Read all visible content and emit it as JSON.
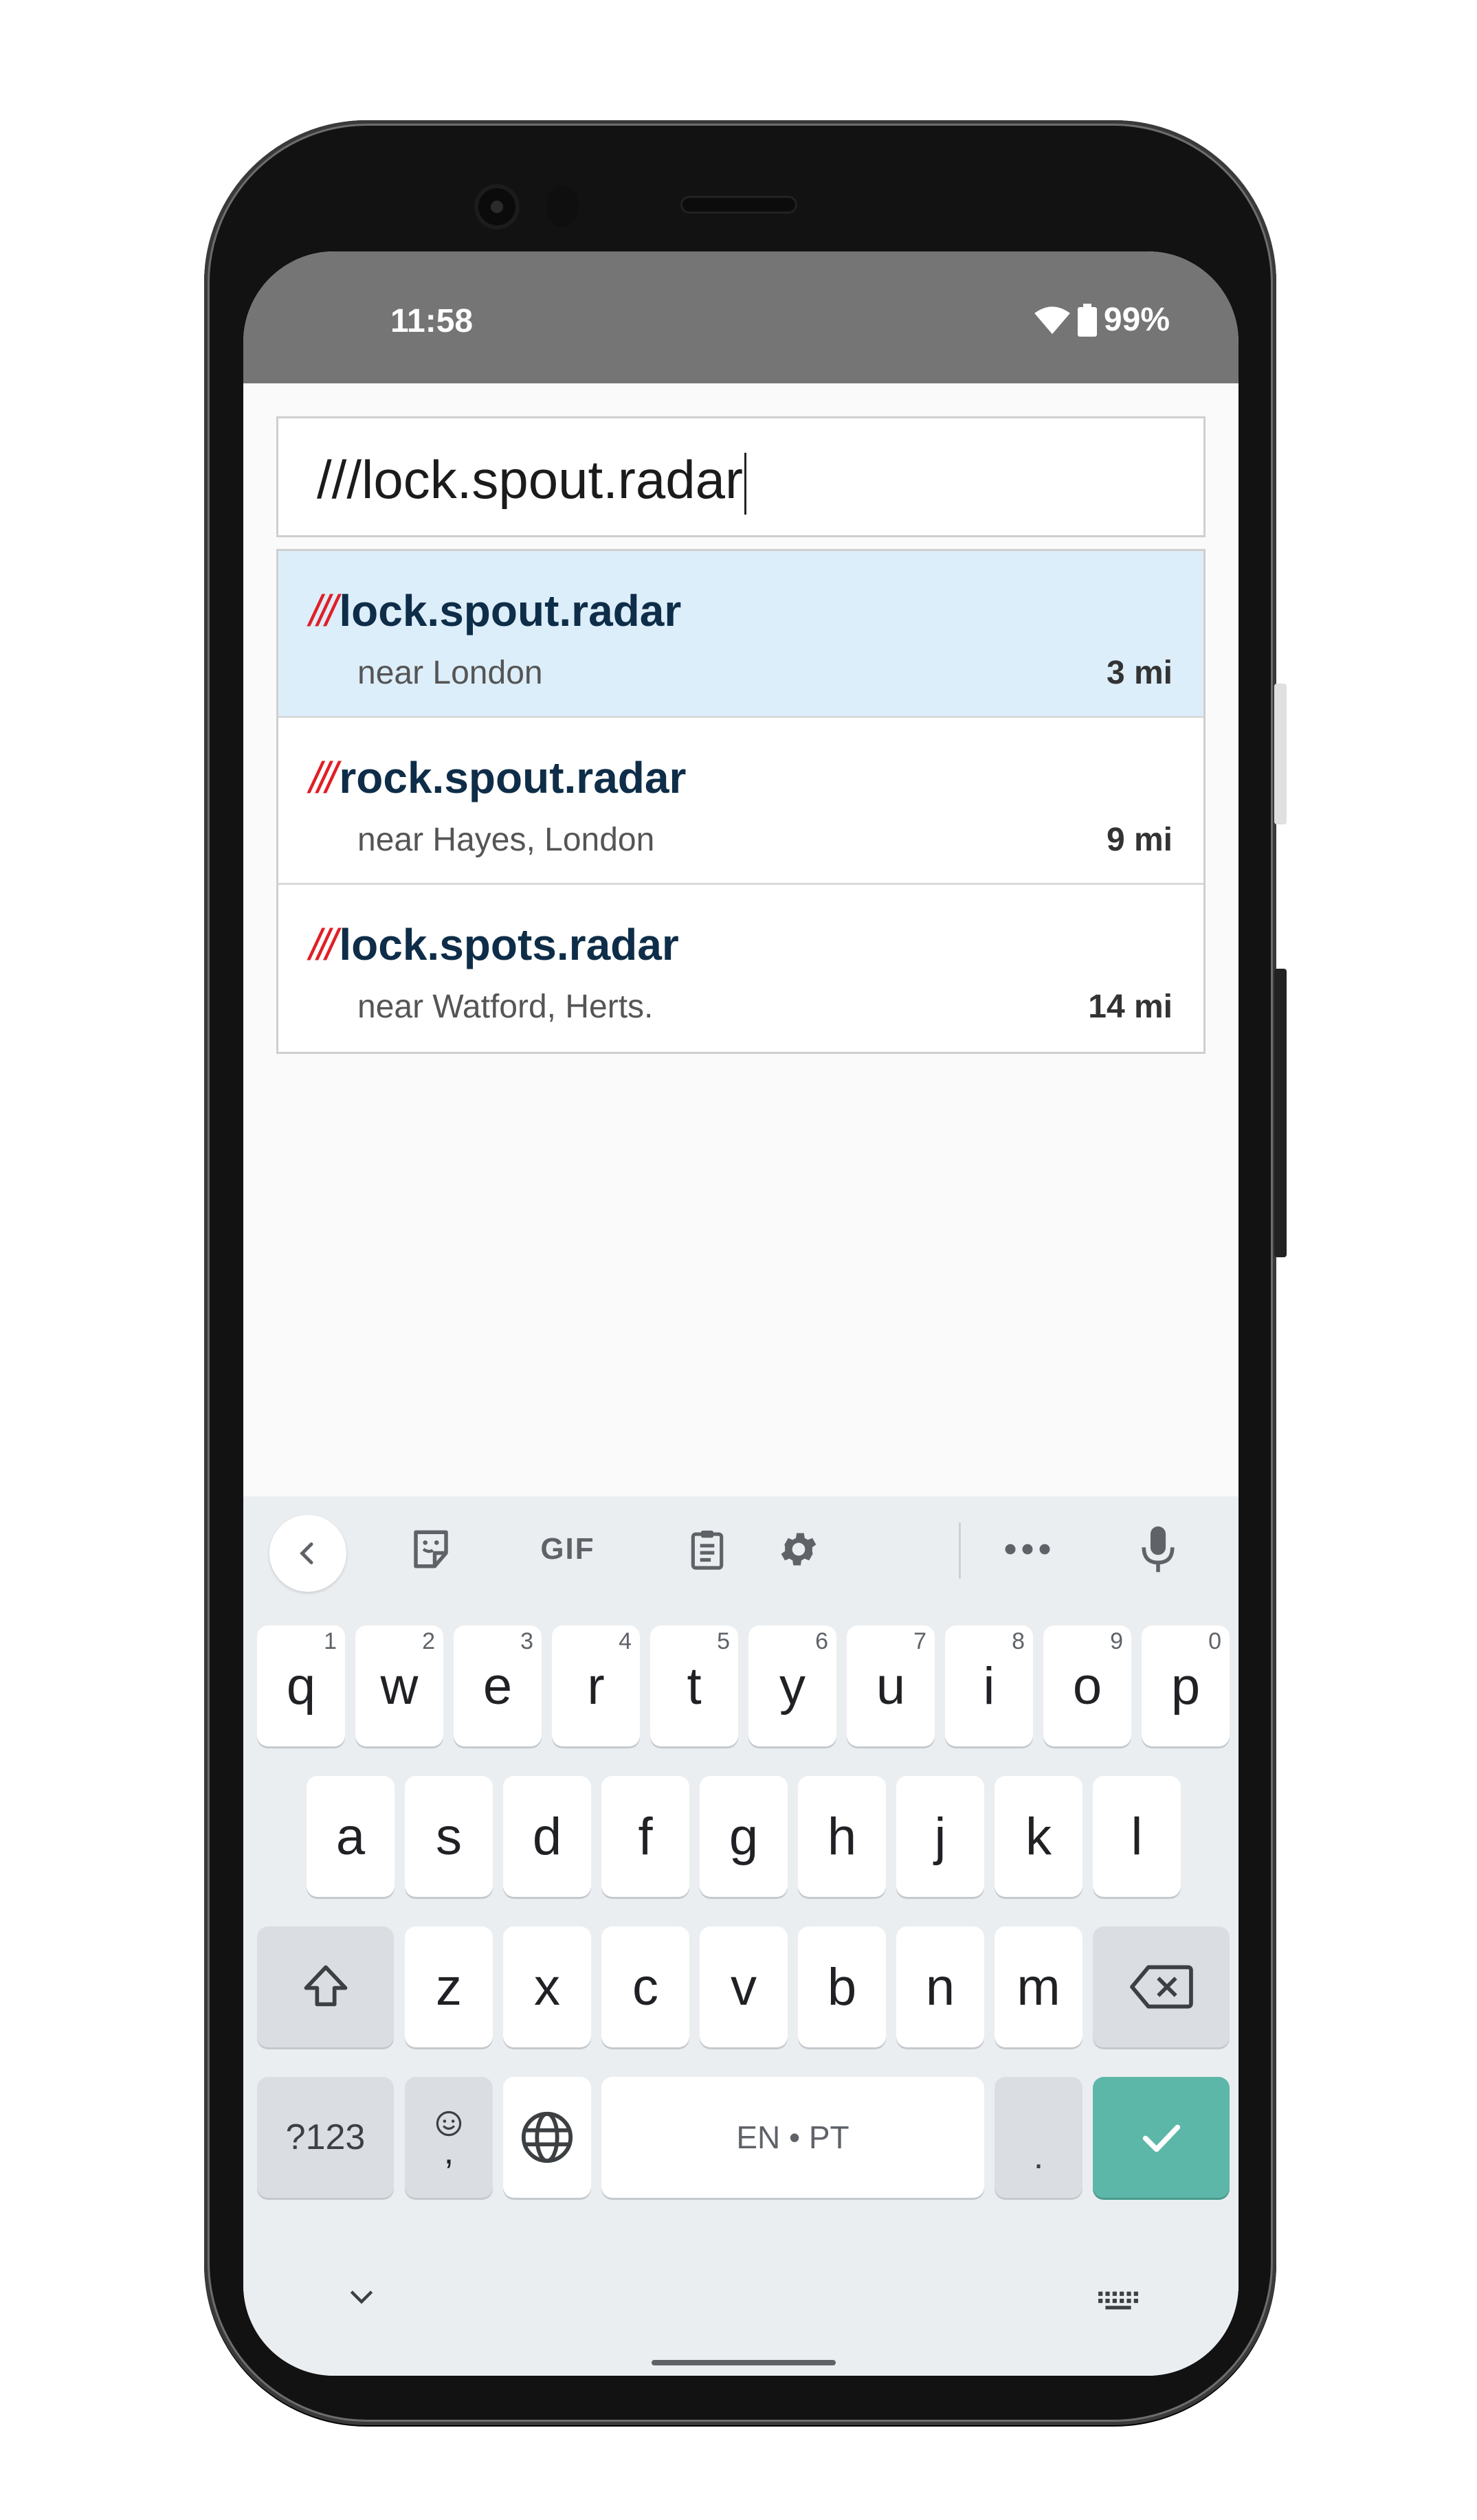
{
  "status_bar": {
    "time": "11:58",
    "battery": "99%"
  },
  "search": {
    "value": "///lock.spout.radar"
  },
  "results": [
    {
      "slash": "///",
      "address": "lock.spout.radar",
      "near": "near London",
      "distance": "3 mi",
      "selected": true
    },
    {
      "slash": "///",
      "address": "rock.spout.radar",
      "near": "near Hayes, London",
      "distance": "9 mi",
      "selected": false
    },
    {
      "slash": "///",
      "address": "lock.spots.radar",
      "near": "near Watford, Herts.",
      "distance": "14 mi",
      "selected": false
    }
  ],
  "keyboard": {
    "toolbar": {
      "gif_label": "GIF"
    },
    "row1": [
      {
        "key": "q",
        "hint": "1"
      },
      {
        "key": "w",
        "hint": "2"
      },
      {
        "key": "e",
        "hint": "3"
      },
      {
        "key": "r",
        "hint": "4"
      },
      {
        "key": "t",
        "hint": "5"
      },
      {
        "key": "y",
        "hint": "6"
      },
      {
        "key": "u",
        "hint": "7"
      },
      {
        "key": "i",
        "hint": "8"
      },
      {
        "key": "o",
        "hint": "9"
      },
      {
        "key": "p",
        "hint": "0"
      }
    ],
    "row2": [
      "a",
      "s",
      "d",
      "f",
      "g",
      "h",
      "j",
      "k",
      "l"
    ],
    "row3": [
      "z",
      "x",
      "c",
      "v",
      "b",
      "n",
      "m"
    ],
    "symbols_label": "?123",
    "comma_label": ",",
    "space_label": "EN • PT",
    "period_label": ".",
    "enter_color": "#5db7a8"
  },
  "colors": {
    "selected_row": "#dceefa",
    "slash_red": "#e11f26",
    "address_navy": "#0e2d48",
    "status_bar": "#757575"
  }
}
